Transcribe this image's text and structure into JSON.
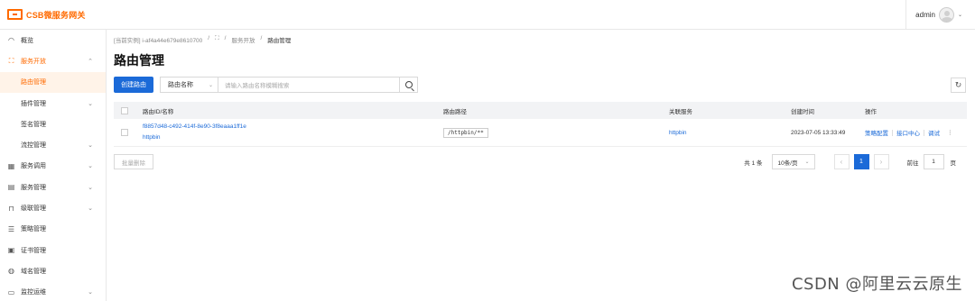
{
  "header": {
    "logo_text": "CSB微服务网关",
    "user": "admin"
  },
  "sidebar": {
    "items": [
      {
        "label": "概览",
        "icon": "dashboard-icon",
        "glyph": "◠",
        "chevron": ""
      },
      {
        "label": "服务开放",
        "icon": "publish-icon",
        "glyph": "⛶",
        "chevron": "⌃"
      },
      {
        "label": "路由管理",
        "icon": "",
        "glyph": "",
        "chevron": ""
      },
      {
        "label": "插件管理",
        "icon": "",
        "glyph": "",
        "chevron": "⌄"
      },
      {
        "label": "签名管理",
        "icon": "",
        "glyph": "",
        "chevron": ""
      },
      {
        "label": "流控管理",
        "icon": "",
        "glyph": "",
        "chevron": "⌄"
      },
      {
        "label": "服务调用",
        "icon": "grid-icon",
        "glyph": "▦",
        "chevron": "⌄"
      },
      {
        "label": "服务管理",
        "icon": "list-icon",
        "glyph": "▤",
        "chevron": "⌄"
      },
      {
        "label": "级联管理",
        "icon": "bookmark-icon",
        "glyph": "⊓",
        "chevron": "⌄"
      },
      {
        "label": "策略管理",
        "icon": "policy-icon",
        "glyph": "☰",
        "chevron": ""
      },
      {
        "label": "证书管理",
        "icon": "certificate-icon",
        "glyph": "▣",
        "chevron": ""
      },
      {
        "label": "域名管理",
        "icon": "globe-icon",
        "glyph": "◍",
        "chevron": ""
      },
      {
        "label": "监控运维",
        "icon": "monitor-icon",
        "glyph": "▭",
        "chevron": "⌄"
      }
    ]
  },
  "breadcrumb": {
    "instance": "[当前实例]  i-af4a44e679e8610700",
    "sep": "/",
    "level1": "服务开放",
    "current": "路由管理"
  },
  "page_title": "路由管理",
  "toolbar": {
    "create_label": "创建路由",
    "filter_field": "路由名称",
    "search_placeholder": "请输入路由名称模糊搜索"
  },
  "table": {
    "headers": {
      "name": "路由ID/名称",
      "path": "路由路径",
      "service": "关联服务",
      "created": "创建时间",
      "ops": "操作"
    },
    "rows": [
      {
        "id": "f8857d48-c492-414f-8e90-3f8eaaa1ff1e",
        "name": "httpbin",
        "path": "/httpbin/**",
        "service": "httpbin",
        "created": "2023-07-05 13:33:49",
        "op1": "策略配置",
        "op2": "接口中心",
        "op3": "调试",
        "more": "⋮"
      }
    ]
  },
  "footer": {
    "bulk_delete": "批量删除",
    "total": "共 1 条",
    "page_size": "10条/页",
    "prev": "‹",
    "current_page": "1",
    "next": "›",
    "goto_label": "前往",
    "goto_value": "1",
    "page_unit": "页"
  },
  "watermark": "CSDN @阿里云云原生",
  "colors": {
    "brand": "#ff6a00",
    "primary": "#1b6ad8"
  }
}
